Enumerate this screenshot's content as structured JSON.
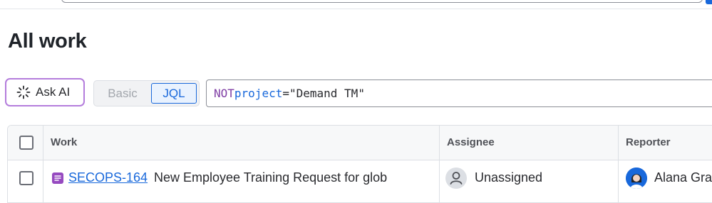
{
  "page": {
    "title": "All work"
  },
  "search_bar": {
    "ask_ai_label": "Ask AI",
    "modes": [
      "Basic",
      "JQL"
    ],
    "active_mode": "JQL",
    "jql_tokens": {
      "keyword": "NOT",
      "field": "project",
      "operator": "=",
      "value": "\"Demand TM\""
    }
  },
  "table": {
    "columns": [
      "Work",
      "Assignee",
      "Reporter"
    ],
    "rows": [
      {
        "issue_type_icon": "story-icon",
        "key": "SECOPS-164",
        "summary": "New Employee Training Request for glob",
        "assignee": "Unassigned",
        "reporter": "Alana Gra"
      }
    ]
  },
  "colors": {
    "accent": "#1868db",
    "ai_border": "#b47ddc",
    "issue_type": "#964ac0",
    "jql_keyword": "#803fa5"
  },
  "icons": {
    "ask_ai": "ai-sparkle-icon",
    "assignee": "unassigned-user-icon",
    "reporter": "user-avatar-icon"
  }
}
